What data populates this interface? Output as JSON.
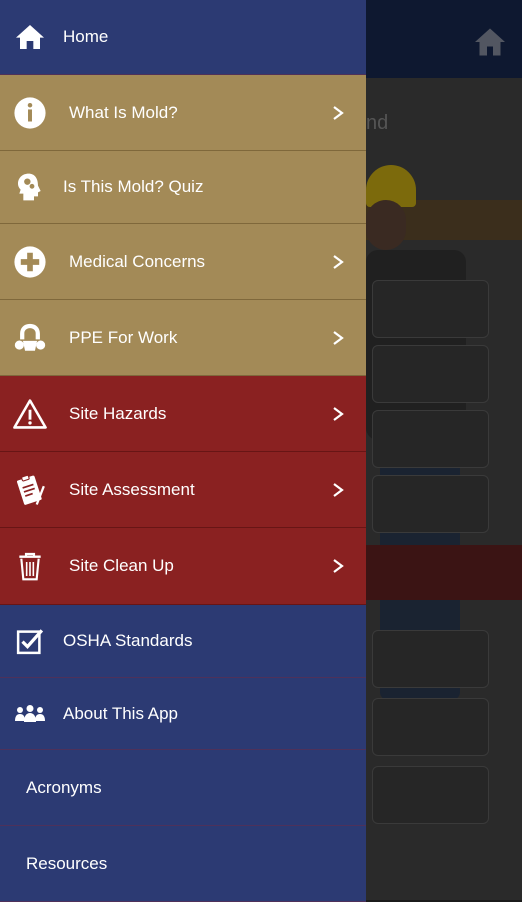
{
  "background": {
    "partial_text": "nd"
  },
  "menu": {
    "items": [
      {
        "label": "Home",
        "icon": "home-icon",
        "chevron": false,
        "color": "#2c3a73"
      },
      {
        "label": "What Is Mold?",
        "icon": "info-icon",
        "chevron": true,
        "color": "#a38a57"
      },
      {
        "label": "Is This Mold? Quiz",
        "icon": "head-gears-icon",
        "chevron": false,
        "color": "#a38a57"
      },
      {
        "label": "Medical Concerns",
        "icon": "medical-cross-icon",
        "chevron": true,
        "color": "#a38a57"
      },
      {
        "label": "PPE For Work",
        "icon": "respirator-icon",
        "chevron": true,
        "color": "#a38a57"
      },
      {
        "label": "Site Hazards",
        "icon": "warning-icon",
        "chevron": true,
        "color": "#8a2121"
      },
      {
        "label": "Site Assessment",
        "icon": "clipboard-icon",
        "chevron": true,
        "color": "#8a2121"
      },
      {
        "label": "Site Clean Up",
        "icon": "trash-icon",
        "chevron": true,
        "color": "#8a2121"
      },
      {
        "label": "OSHA Standards",
        "icon": "checkbox-icon",
        "chevron": false,
        "color": "#2c3a73"
      },
      {
        "label": "About This App",
        "icon": "group-icon",
        "chevron": false,
        "color": "#2c3a73"
      },
      {
        "label": "Acronyms",
        "icon": "",
        "chevron": false,
        "color": "#2c3a73"
      },
      {
        "label": "Resources",
        "icon": "",
        "chevron": false,
        "color": "#2c3a73"
      }
    ]
  }
}
